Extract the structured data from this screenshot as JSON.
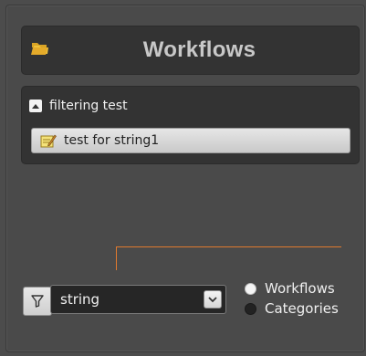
{
  "header": {
    "title": "Workflows",
    "icon": "folder-stack-icon"
  },
  "group": {
    "title": "filtering test",
    "expanded": true,
    "items": [
      {
        "label": "test for string1",
        "icon": "workflow-edit-icon"
      }
    ]
  },
  "filter": {
    "icon": "filter-funnel-icon",
    "value": "string"
  },
  "scope": {
    "options": [
      {
        "label": "Workflows",
        "selected": true
      },
      {
        "label": "Categories",
        "selected": false
      }
    ]
  },
  "colors": {
    "accent_connector": "#e07a2e",
    "panel_bg": "#333333",
    "window_bg": "#4a4a4a"
  }
}
